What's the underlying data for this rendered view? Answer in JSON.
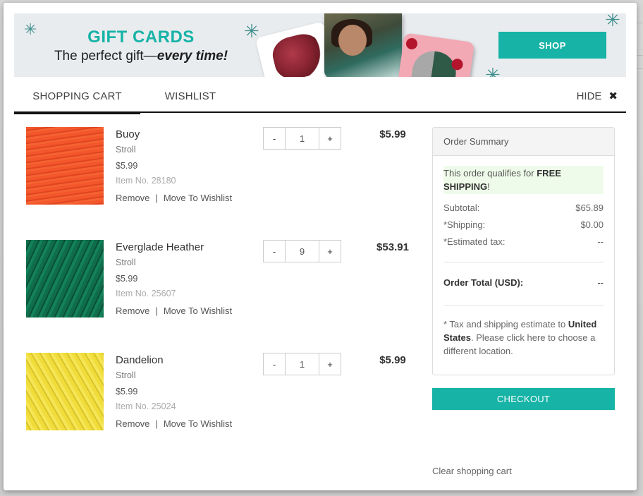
{
  "banner": {
    "title": "GIFT CARDS",
    "subtitle_plain": "The perfect gift—",
    "subtitle_emphasis": "every time!",
    "shop_label": "SHOP",
    "snowflake_glyph": "✳"
  },
  "tabs": {
    "cart_label": "SHOPPING CART",
    "wishlist_label": "WISHLIST",
    "active": "SHOPPING CART",
    "hide_label": "HIDE",
    "hide_icon": "✖"
  },
  "items": [
    {
      "name": "Buoy",
      "line": "Stroll",
      "unit_price": "$5.99",
      "sku": "Item No. 28180",
      "quantity": "1",
      "line_total": "$5.99",
      "color": "#f2562a",
      "remove_label": "Remove",
      "separator": "|",
      "wishlist_label": "Move To Wishlist",
      "minus_label": "-",
      "plus_label": "+"
    },
    {
      "name": "Everglade Heather",
      "line": "Stroll",
      "unit_price": "$5.99",
      "sku": "Item No. 25607",
      "quantity": "9",
      "line_total": "$53.91",
      "color": "#0f6d4b",
      "remove_label": "Remove",
      "separator": "|",
      "wishlist_label": "Move To Wishlist",
      "minus_label": "-",
      "plus_label": "+"
    },
    {
      "name": "Dandelion",
      "line": "Stroll",
      "unit_price": "$5.99",
      "sku": "Item No. 25024",
      "quantity": "1",
      "line_total": "$5.99",
      "color": "#f0dc3a",
      "remove_label": "Remove",
      "separator": "|",
      "wishlist_label": "Move To Wishlist",
      "minus_label": "-",
      "plus_label": "+"
    }
  ],
  "summary": {
    "title": "Order Summary",
    "free_ship_prefix": "This order qualifies for ",
    "free_ship_bold": "FREE SHIPPING",
    "free_ship_suffix": "!",
    "subtotal_label": "Subtotal:",
    "subtotal_value": "$65.89",
    "shipping_label": "*Shipping:",
    "shipping_value": "$0.00",
    "tax_label": "*Estimated tax:",
    "tax_value": "--",
    "total_label": "Order Total (USD):",
    "total_value": "--",
    "note_prefix": "* Tax and shipping estimate to ",
    "note_country": "United States",
    "note_suffix": ". Please click here to choose a different location."
  },
  "checkout_label": "CHECKOUT",
  "clear_cart_label": "Clear shopping cart",
  "colors": {
    "accent": "#16b3a6",
    "free_ship_bg": "#effbea",
    "banner_bg": "#e9ecef"
  }
}
